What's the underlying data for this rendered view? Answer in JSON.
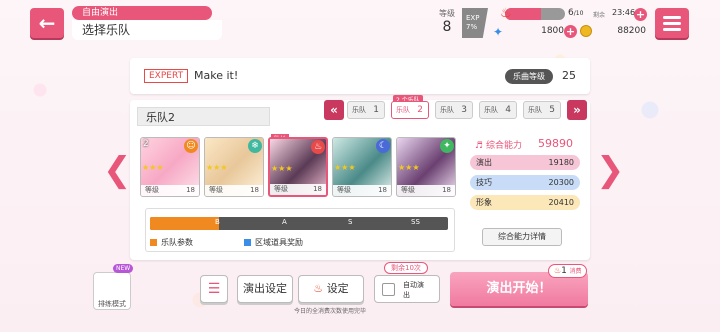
{
  "header": {
    "back_icon": "back-arrow-icon",
    "mode_tag": "自由演出",
    "page_title": "选择乐队",
    "level_label": "等级",
    "level": "8",
    "exp_label": "EXP",
    "exp_percent": "7%",
    "stamina_current": "6",
    "stamina_max": "/10",
    "stamina_fill": 0.6,
    "time_label": "剩余",
    "time": "23:46",
    "star_count": "1800",
    "coin_count": "88200",
    "accent_color": "#e8567a"
  },
  "song": {
    "difficulty": "EXPERT",
    "name": "Make it!",
    "level_label": "乐曲等级",
    "level": "25"
  },
  "band": {
    "name": "乐队2",
    "tab_marker": "2 个乐队",
    "tabs": [
      {
        "label": "乐队",
        "num": "1"
      },
      {
        "label": "乐队",
        "num": "2"
      },
      {
        "label": "乐队",
        "num": "3"
      },
      {
        "label": "乐队",
        "num": "4"
      },
      {
        "label": "乐队",
        "num": "5"
      }
    ],
    "leader_label": "队长",
    "cards": [
      {
        "rank": "2",
        "level_label": "等级",
        "level": "18"
      },
      {
        "rank": "",
        "level_label": "等级",
        "level": "18"
      },
      {
        "rank": "",
        "level_label": "等级",
        "level": "18"
      },
      {
        "rank": "",
        "level_label": "等级",
        "level": "18"
      },
      {
        "rank": "",
        "level_label": "等级",
        "level": "18"
      }
    ]
  },
  "stats": {
    "total_label": "综合能力",
    "total": "59890",
    "performance_label": "演出",
    "performance": "19180",
    "technique_label": "技巧",
    "technique": "20300",
    "visual_label": "形象",
    "visual": "20410",
    "details_button": "综合能力详情"
  },
  "gauge": {
    "fill_fraction": 0.23,
    "marks": [
      "B",
      "A",
      "S",
      "SS"
    ],
    "legend_band": "乐队参数",
    "legend_item": "区域道具奖励"
  },
  "bottom": {
    "rehearsal_label": "排练模式",
    "new_badge": "NEW",
    "show_settings": "演出设定",
    "settings": "设定",
    "remaining": "剩余10次",
    "auto_label": "自动演出",
    "start": "演出开始！",
    "cost": "1",
    "cost_label": "消费",
    "note": "今日的全消费次数使用完毕"
  }
}
